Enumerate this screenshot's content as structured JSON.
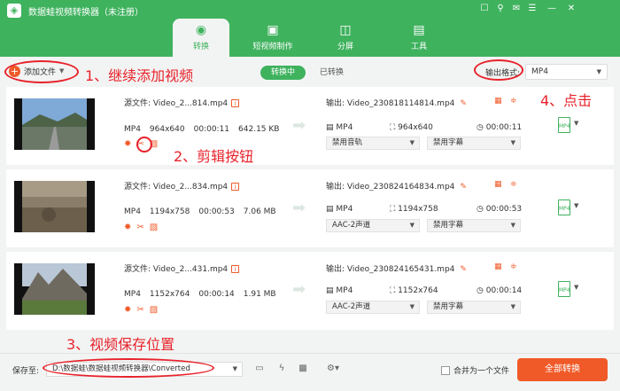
{
  "app": {
    "title": "数据蛙视频转换器（未注册）"
  },
  "window_buttons": [
    "☐",
    "⚲",
    "✉",
    "☰",
    "—",
    "✕"
  ],
  "tabs": [
    {
      "label": "转换",
      "icon": "convert-icon"
    },
    {
      "label": "短视频制作",
      "icon": "tv-icon"
    },
    {
      "label": "分屏",
      "icon": "split-screen-icon"
    },
    {
      "label": "工具",
      "icon": "toolbox-icon"
    }
  ],
  "toolbar": {
    "add_label": "添加文件",
    "seg_active": "转换中",
    "seg_inactive": "已转换",
    "format_label": "输出格式:",
    "format_value": "MP4"
  },
  "files": [
    {
      "source": "源文件: Video_2...814.mp4",
      "format": "MP4",
      "res": "964x640",
      "duration": "00:00:11",
      "size": "642.15 KB",
      "output": "输出: Video_230818114814.mp4",
      "out_format": "MP4",
      "out_res": "964x640",
      "out_duration": "00:00:11",
      "audio": "禁用音轨",
      "subtitle": "禁用字幕"
    },
    {
      "source": "源文件: Video_2...834.mp4",
      "format": "MP4",
      "res": "1194x758",
      "duration": "00:00:53",
      "size": "7.06 MB",
      "output": "输出: Video_230824164834.mp4",
      "out_format": "MP4",
      "out_res": "1194x758",
      "out_duration": "00:00:53",
      "audio": "AAC-2声道",
      "subtitle": "禁用字幕"
    },
    {
      "source": "源文件: Video_2...431.mp4",
      "format": "MP4",
      "res": "1152x764",
      "duration": "00:00:14",
      "size": "1.91 MB",
      "output": "输出: Video_230824165431.mp4",
      "out_format": "MP4",
      "out_res": "1152x764",
      "out_duration": "00:00:14",
      "audio": "AAC-2声道",
      "subtitle": "禁用字幕"
    }
  ],
  "bottom": {
    "save_label": "保存至:",
    "path": "D:\\数据蛙\\数据蛙视频转换器\\Converted",
    "merge_label": "合并为一个文件",
    "convert_label": "全部转换"
  },
  "annotations": {
    "a1": "1、继续添加视频",
    "a2": "2、剪辑按钮",
    "a3": "3、视频保存位置",
    "a4": "4、点击"
  },
  "colors": {
    "brand": "#3fb25e",
    "accent": "#f05a28",
    "annotation": "#e8222b"
  }
}
